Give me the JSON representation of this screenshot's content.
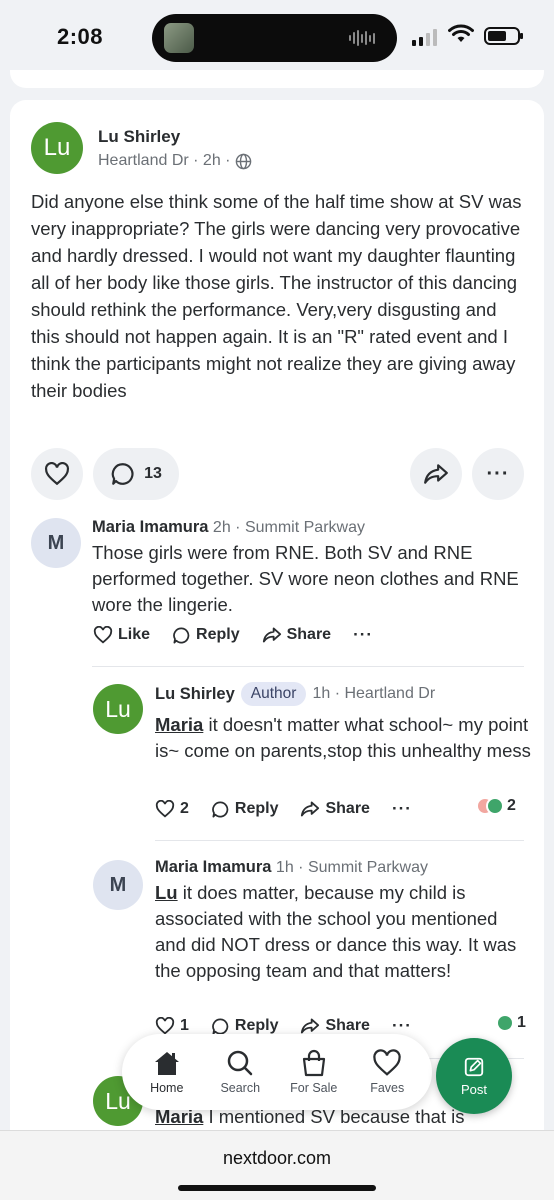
{
  "status_bar": {
    "time": "2:08"
  },
  "post": {
    "author_initials": "Lu",
    "author": "Lu Shirley",
    "meta": "Heartland Dr · 2h ·",
    "body": "Did anyone else think some of the half time show at SV was very inappropriate? The girls were dancing very provocative and hardly dressed. I would not want my daughter flaunting all of her body like those girls. The instructor of this dancing should rethink the performance.  Very,very disgusting and this should not happen again. It is an \"R\" rated event and I think the participants might not realize they are giving away their bodies",
    "comment_count": "13"
  },
  "comments": [
    {
      "initials": "M",
      "author": "Maria Imamura",
      "time": "2h",
      "location": "· Summit Parkway",
      "text": "Those girls were from RNE. Both SV and RNE performed together. SV wore neon clothes and RNE wore the lingerie.",
      "like_label": "Like",
      "reply_label": "Reply",
      "share_label": "Share"
    },
    {
      "initials": "Lu",
      "author": "Lu Shirley",
      "badge": "Author",
      "time": "1h",
      "location": "· Heartland Dr",
      "mention": "Maria",
      "text": " it doesn't matter what school~ my point is~ come on parents,stop this unhealthy mess",
      "like_count": "2",
      "reply_label": "Reply",
      "share_label": "Share",
      "reaction_count": "2"
    },
    {
      "initials": "M",
      "author": "Maria Imamura",
      "time": "1h",
      "location": "· Summit Parkway",
      "mention": "Lu",
      "text": " it does matter, because my child is associated with the school you mentioned and did NOT dress or dance this way. It was the opposing team and that matters!",
      "like_count": "1",
      "reply_label": "Reply",
      "share_label": "Share",
      "reaction_count": "1"
    },
    {
      "initials": "Lu",
      "mention": "Maria",
      "text": " I mentioned SV because that is"
    }
  ],
  "tabbar": {
    "items": [
      {
        "label": "Home",
        "icon": "home-icon"
      },
      {
        "label": "Search",
        "icon": "search-icon"
      },
      {
        "label": "For Sale",
        "icon": "bag-icon"
      },
      {
        "label": "Faves",
        "icon": "heart-icon"
      }
    ],
    "post_label": "Post"
  },
  "browser": {
    "url": "nextdoor.com"
  },
  "colors": {
    "brand_green": "#1a8b55",
    "avatar_green": "#4f9a32",
    "avatar_grey": "#dfe4f0"
  }
}
